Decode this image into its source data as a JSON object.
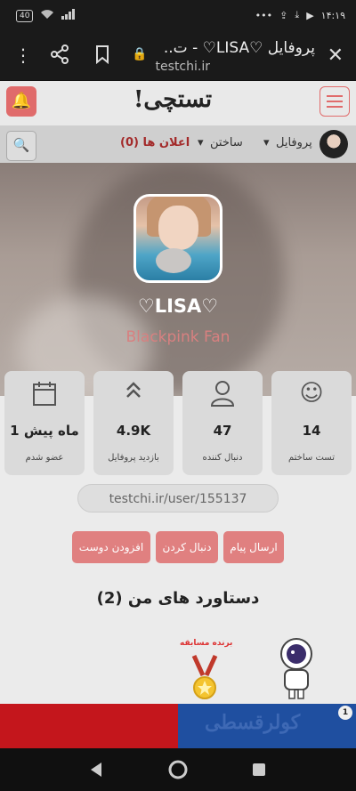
{
  "status_bar": {
    "battery": "40",
    "time": "۱۴:۱۹",
    "dots": "•••"
  },
  "browser": {
    "title": "پروفایل ♡LISA♡ - ت..",
    "url": "testchi.ir"
  },
  "site": {
    "logo": "تستچی!"
  },
  "nav": {
    "items": [
      {
        "label": "پروفایل"
      },
      {
        "label": "ساختن"
      },
      {
        "label": "اعلان ها (0)"
      }
    ]
  },
  "profile": {
    "username": "♡LISA♡",
    "bio": "Blackpink Fan",
    "link": "testchi.ir/user/155137"
  },
  "stats": [
    {
      "icon": "smiley-icon",
      "glyph": "☺",
      "value": "14",
      "label": "تست ساختم"
    },
    {
      "icon": "user-icon",
      "glyph": "👤",
      "value": "47",
      "label": "دنبال کننده"
    },
    {
      "icon": "double-chevron-up-icon",
      "glyph": "︽",
      "value": "4.9K",
      "label": "بازدید پروفایل"
    },
    {
      "icon": "calendar-icon",
      "glyph": "📅",
      "value": "1 ماه پیش",
      "label": "عضو شدم"
    }
  ],
  "actions": {
    "message": "ارسال پیام",
    "follow": "دنبال کردن",
    "add_friend": "افزودن دوست"
  },
  "achievements": {
    "title": "دستاورد های من (2)",
    "badge_caption": "برنده مسابقه"
  },
  "banner": {
    "text": "کولرقسطی",
    "counter": "1"
  }
}
